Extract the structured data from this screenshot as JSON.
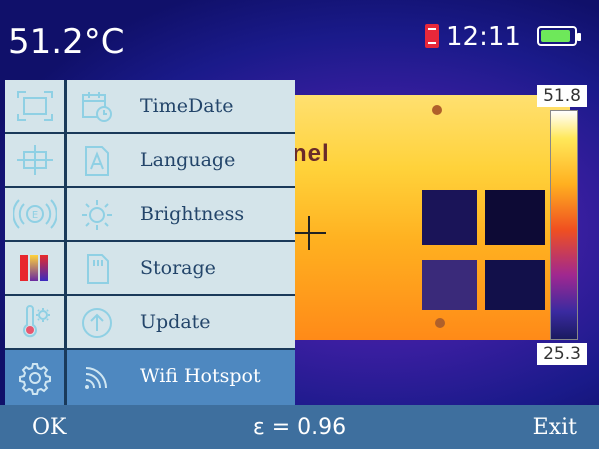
{
  "status": {
    "temperature": "51.2°C",
    "time": "12:11",
    "battery_level": 0.9,
    "colors": {
      "battery": "#6ee85a",
      "warning": "#e8283a"
    }
  },
  "scale": {
    "max": "51.8",
    "min": "25.3"
  },
  "thermal_image": {
    "logo_text": "nel"
  },
  "menu": {
    "selected_index": 5,
    "items": [
      {
        "label": "TimeDate",
        "icon": "calendar-clock-icon",
        "side_icon": "frame-icon"
      },
      {
        "label": "Language",
        "icon": "language-a-icon",
        "side_icon": "crosshair-box-icon"
      },
      {
        "label": "Brightness",
        "icon": "sun-icon",
        "side_icon": "emissivity-icon"
      },
      {
        "label": "Storage",
        "icon": "sd-card-icon",
        "side_icon": "palette-icon"
      },
      {
        "label": "Update",
        "icon": "upload-arrow-icon",
        "side_icon": "thermometer-gear-icon"
      },
      {
        "label": "Wifi Hotspot",
        "icon": "wifi-icon",
        "side_icon": "settings-gear-icon"
      }
    ]
  },
  "bottom": {
    "ok_label": "OK",
    "emissivity": "ε = 0.96",
    "exit_label": "Exit",
    "color": "#3e6f9e"
  }
}
